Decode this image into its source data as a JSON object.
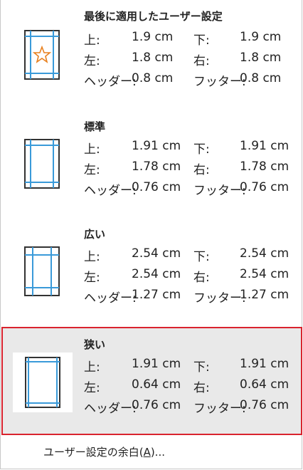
{
  "presets": [
    {
      "title": "最後に適用したユーザー設定",
      "top_label": "上:",
      "top": "1.9 cm",
      "bottom_label": "下:",
      "bottom": "1.9 cm",
      "left_label": "左:",
      "left": "1.8 cm",
      "right_label": "右:",
      "right": "1.8 cm",
      "header_label": "ヘッダー:",
      "header": "0.8 cm",
      "footer_label": "フッター:",
      "footer": "0.8 cm",
      "icon": "star-icon"
    },
    {
      "title": "標準",
      "top_label": "上:",
      "top": "1.91 cm",
      "bottom_label": "下:",
      "bottom": "1.91 cm",
      "left_label": "左:",
      "left": "1.78 cm",
      "right_label": "右:",
      "right": "1.78 cm",
      "header_label": "ヘッダー:",
      "header": "0.76 cm",
      "footer_label": "フッター:",
      "footer": "0.76 cm"
    },
    {
      "title": "広い",
      "top_label": "上:",
      "top": "2.54 cm",
      "bottom_label": "下:",
      "bottom": "2.54 cm",
      "left_label": "左:",
      "left": "2.54 cm",
      "right_label": "右:",
      "right": "2.54 cm",
      "header_label": "ヘッダー:",
      "header": "1.27 cm",
      "footer_label": "フッター:",
      "footer": "1.27 cm"
    },
    {
      "title": "狭い",
      "top_label": "上:",
      "top": "1.91 cm",
      "bottom_label": "下:",
      "bottom": "1.91 cm",
      "left_label": "左:",
      "left": "0.64 cm",
      "right_label": "右:",
      "right": "0.64 cm",
      "header_label": "ヘッダー:",
      "header": "0.76 cm",
      "footer_label": "フッター:",
      "footer": "0.76 cm",
      "selected": true
    }
  ],
  "custom_margins": {
    "label": "ユーザー設定の余白(",
    "accel": "A",
    "suffix": ")..."
  },
  "colors": {
    "guide": "#3a9ad9",
    "selected_border": "#d9232e",
    "star": "#e8801e",
    "page_border": "#333333"
  }
}
